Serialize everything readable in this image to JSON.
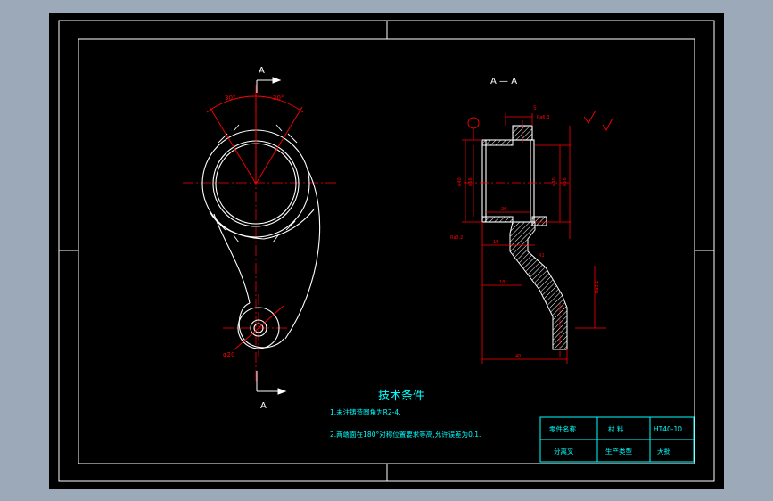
{
  "colors": {
    "background": "#000000",
    "frame": "#ffffff",
    "part": "#ffffff",
    "dimension": "#ff0000",
    "text": "#00ffff",
    "table_line": "#00ffff",
    "app_bg": "#9ba9b9",
    "hatch": "#ffffff"
  },
  "labels": {
    "view_a_top": "A",
    "view_a_bottom": "A",
    "section_title": "A — A",
    "tech_title": "技术条件",
    "note_1": "1.未注铸造圆角为R2-4.",
    "note_2": "2.两端面在180°对称位置要求等高,允许误差为0.1.",
    "dims": {
      "ang_left": "30°",
      "ang_right": "30°",
      "dia_small": "φ20",
      "d_top": "5",
      "d_roughness": "Ra6.3",
      "d_left_a": "φ40",
      "d_left_b": "φ56",
      "d_right_a": "φ40",
      "d_right_b": "φ56",
      "d_mid": "26",
      "d_bot_a": "15",
      "d_bot_b": "18",
      "d_bot_c": "40",
      "d_chamfer": "R1",
      "d_vertical": "Ra3.2",
      "d_left_rough": "Ra3.2"
    }
  },
  "title_block": {
    "cells": [
      [
        "零件名称",
        "材 料",
        "HT40-10"
      ],
      [
        "分离叉",
        "生产类型",
        "大批"
      ]
    ]
  }
}
